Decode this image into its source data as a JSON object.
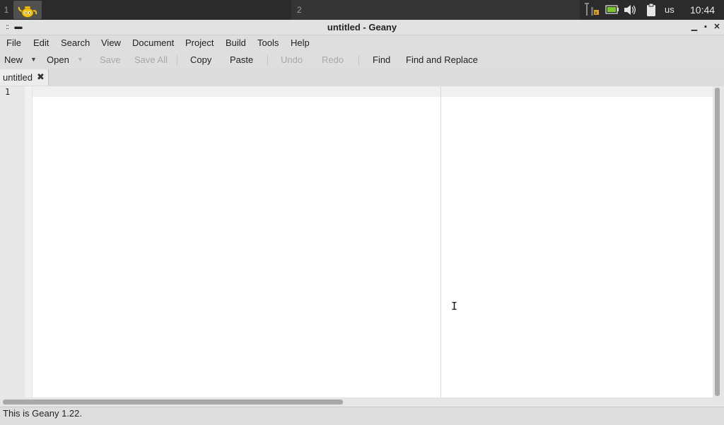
{
  "panel": {
    "workspace1": "1",
    "workspace2": "2",
    "app_icon": "geany-teapot-icon",
    "tray_icons": [
      "network-wired-icon",
      "battery-icon",
      "volume-icon",
      "clipboard-icon"
    ],
    "keyboard_layout": "us",
    "clock": "10:44"
  },
  "window": {
    "title": "untitled - Geany",
    "controls": {
      "minimize": "▁",
      "maximize": "▪",
      "close": "✕"
    }
  },
  "menubar": {
    "items": [
      "File",
      "Edit",
      "Search",
      "View",
      "Document",
      "Project",
      "Build",
      "Tools",
      "Help"
    ]
  },
  "toolbar": {
    "new": "New",
    "open": "Open",
    "save": "Save",
    "save_all": "Save All",
    "copy": "Copy",
    "paste": "Paste",
    "undo": "Undo",
    "redo": "Redo",
    "find": "Find",
    "find_replace": "Find and Replace",
    "dropdown_glyph": "▼"
  },
  "tabs": [
    {
      "label": "untitled",
      "close": "✖"
    }
  ],
  "editor": {
    "line_numbers": [
      "1"
    ],
    "content": "",
    "cursor_glyph": "I"
  },
  "statusbar": {
    "text": "This is Geany 1.22."
  },
  "colors": {
    "panel_bg": "#2b2b2b",
    "chrome_bg": "#dedede",
    "long_line_marker": "#cfe3c8"
  }
}
